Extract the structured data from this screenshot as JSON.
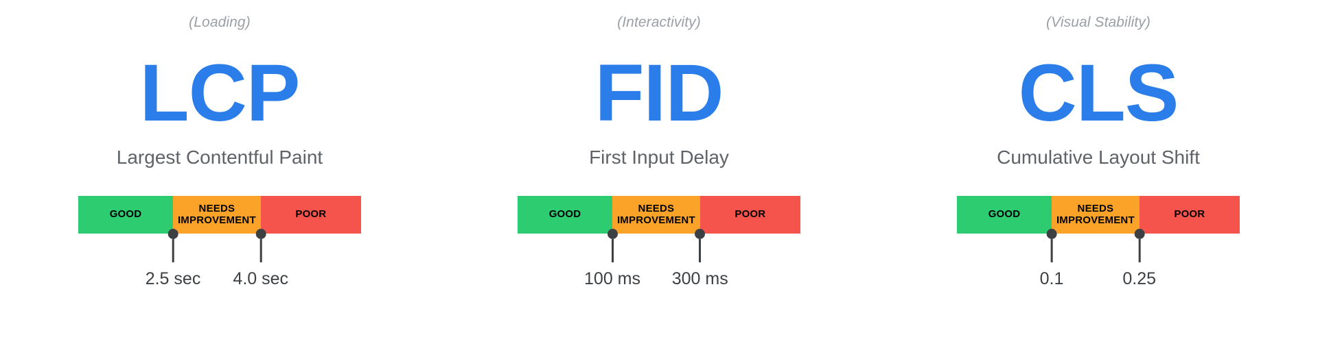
{
  "colors": {
    "good": "#2ecc71",
    "needs_improvement": "#fba229",
    "poor": "#f4544b",
    "accent_blue": "#2b7de9",
    "category_gray": "#9aa0a6",
    "name_gray": "#5f6368",
    "marker_dark": "#3c4043",
    "background": "#ffffff"
  },
  "metrics": [
    {
      "category": "(Loading)",
      "acronym": "LCP",
      "name": "Largest Contentful Paint",
      "segments": [
        {
          "label": "GOOD"
        },
        {
          "label": "NEEDS\nIMPROVEMENT"
        },
        {
          "label": "POOR"
        }
      ],
      "thresholds": [
        {
          "value": "2.5 sec",
          "position_pct": 33.5
        },
        {
          "value": "4.0 sec",
          "position_pct": 64.5
        }
      ]
    },
    {
      "category": "(Interactivity)",
      "acronym": "FID",
      "name": "First Input Delay",
      "segments": [
        {
          "label": "GOOD"
        },
        {
          "label": "NEEDS\nIMPROVEMENT"
        },
        {
          "label": "POOR"
        }
      ],
      "thresholds": [
        {
          "value": "100 ms",
          "position_pct": 33.5
        },
        {
          "value": "300 ms",
          "position_pct": 64.5
        }
      ]
    },
    {
      "category": "(Visual Stability)",
      "acronym": "CLS",
      "name": "Cumulative Layout Shift",
      "segments": [
        {
          "label": "GOOD"
        },
        {
          "label": "NEEDS\nIMPROVEMENT"
        },
        {
          "label": "POOR"
        }
      ],
      "thresholds": [
        {
          "value": "0.1",
          "position_pct": 33.5
        },
        {
          "value": "0.25",
          "position_pct": 64.5
        }
      ]
    }
  ]
}
